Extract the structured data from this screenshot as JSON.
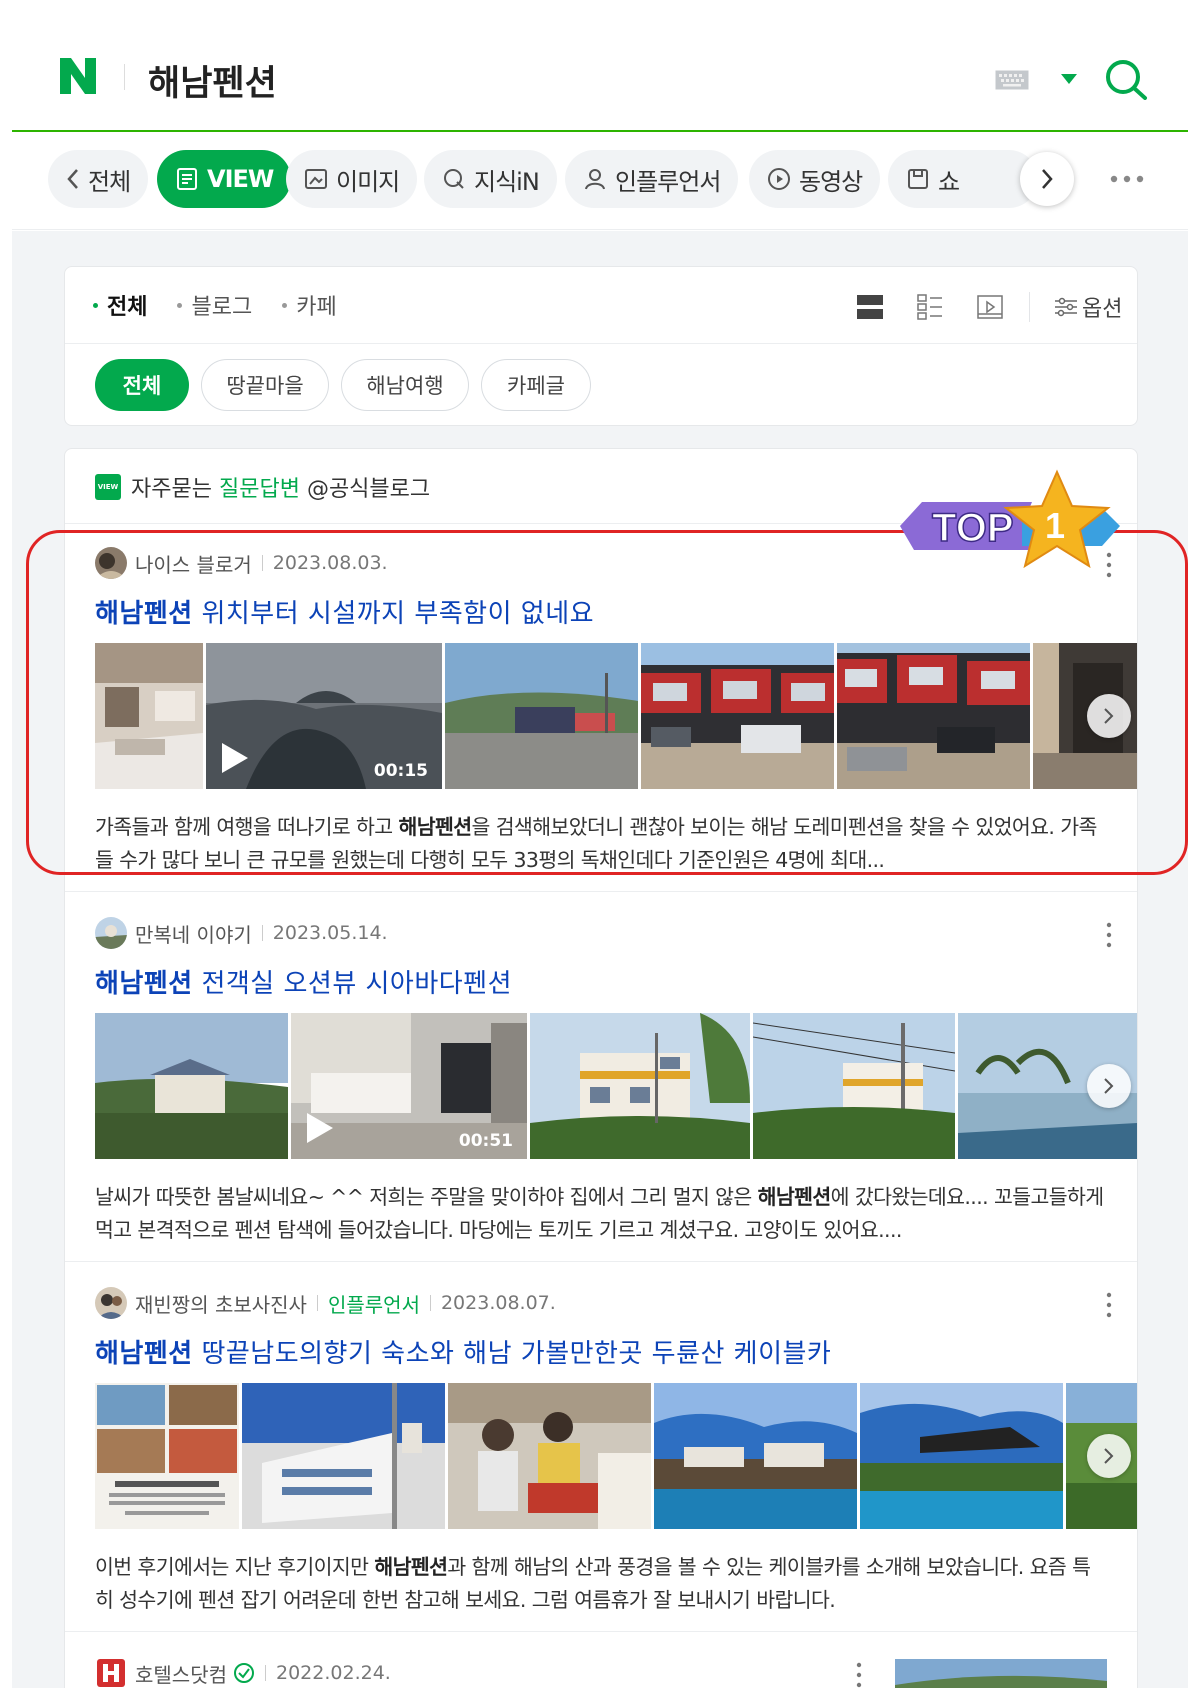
{
  "header": {
    "logo_letter": "N",
    "query": "해남펜션",
    "brand_color": "#03a94d",
    "icons": [
      "keyboard-icon",
      "chevron-down-icon",
      "search-icon"
    ]
  },
  "tabs": [
    {
      "label": "전체",
      "icon": "chevron-left-icon"
    },
    {
      "label": "VIEW",
      "icon": "document-icon"
    },
    {
      "label": "이미지",
      "icon": "image-icon"
    },
    {
      "label": "지식iN",
      "icon": "q-icon"
    },
    {
      "label": "인플루언서",
      "icon": "person-icon"
    },
    {
      "label": "동영상",
      "icon": "play-circle-icon"
    },
    {
      "label": "쇼",
      "icon": "bag-icon"
    }
  ],
  "filters": {
    "subtabs": [
      "전체",
      "블로그",
      "카페"
    ],
    "option_label": "옵션",
    "chips": [
      "전체",
      "땅끝마을",
      "해남여행",
      "카페글"
    ]
  },
  "section": {
    "prefix": "자주묻는",
    "highlight": "질문답변",
    "suffix": "@공식블로그",
    "badge": "VIEW"
  },
  "top_badge": {
    "text": "TOP",
    "rank": "1"
  },
  "posts": [
    {
      "author": "나이스 블로거",
      "influencer": "",
      "date": "2023.08.03.",
      "title_bold": "해남펜션",
      "title_rest": " 위치부터 시설까지 부족함이 없네요",
      "video_duration": "00:15",
      "desc_a": "가족들과 함께 여행을 떠나기로 하고 ",
      "desc_bold": "해남펜션",
      "desc_b": "을 검색해보았더니 괜찮아 보이는 해남 도레미펜션을 찾을 수 있었어요. 가족들 수가 많다 보니 큰 규모를 원했는데 다행히 모두 33평의 독채인데다 기준인원은 4명에 최대..."
    },
    {
      "author": "만복네 이야기",
      "influencer": "",
      "date": "2023.05.14.",
      "title_bold": "해남펜션",
      "title_rest": " 전객실 오션뷰 시아바다펜션",
      "video_duration": "00:51",
      "desc_a": "날씨가 따뜻한 봄날씨네요~ ^^ 저희는 주말을 맞이하야 집에서 그리 멀지 않은 ",
      "desc_bold": "해남펜션",
      "desc_b": "에 갔다왔는데요.... 꼬들고들하게 먹고 본격적으로 펜션 탐색에 들어갔습니다. 마당에는 토끼도 기르고 계셨구요. 고양이도 있어요...."
    },
    {
      "author": "재빈짱의 초보사진사",
      "influencer": "인플루언서",
      "date": "2023.08.07.",
      "title_bold": "해남펜션",
      "title_rest": " 땅끝남도의향기 숙소와 해남 가볼만한곳 두륜산 케이블카",
      "video_duration": "",
      "desc_a": "이번 후기에서는 지난 후기이지만 ",
      "desc_bold": "해남펜션",
      "desc_b": "과 함께 해남의 산과 풍경을 볼 수 있는 케이블카를 소개해 보았습니다. 요즘 특히 성수기에 펜션 잡기 어려운데 한번 참고해 보세요. 그럼 여름휴가 잘 보내시기 바랍니다."
    },
    {
      "author": "호텔스닷컴",
      "influencer": "",
      "date": "2022.02.24.",
      "title_bold": "",
      "title_rest": "",
      "video_duration": "",
      "desc_a": "",
      "desc_bold": "",
      "desc_b": ""
    }
  ],
  "colors": {
    "accent": "#03a94d",
    "title_link": "#0c43b7",
    "highlight_border": "#e02424"
  }
}
